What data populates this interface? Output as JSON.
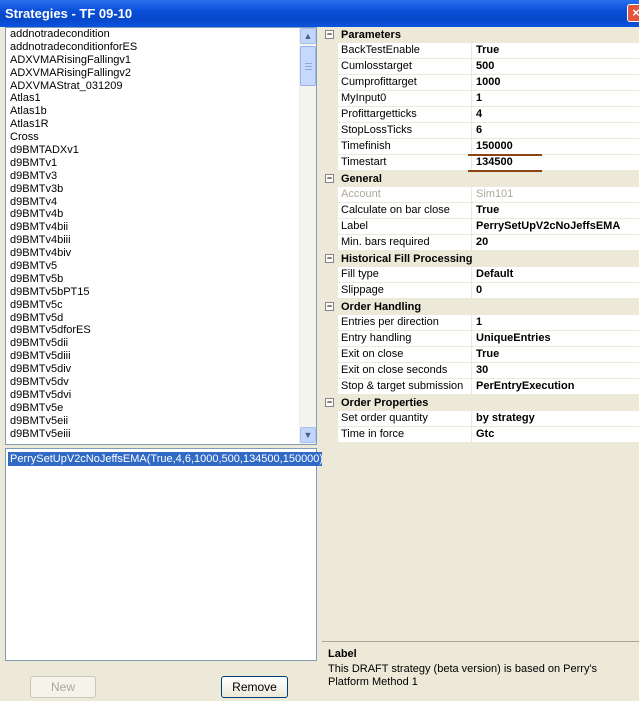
{
  "window": {
    "title": "Strategies - TF 09-10",
    "close_glyph": "×"
  },
  "strategies_list": {
    "items": [
      "addnotradecondition",
      "addnotradeconditionforES",
      "ADXVMARisingFallingv1",
      "ADXVMARisingFallingv2",
      "ADXVMAStrat_031209",
      "Atlas1",
      "Atlas1b",
      "Atlas1R",
      "Cross",
      "d9BMTADXv1",
      "d9BMTv1",
      "d9BMTv3",
      "d9BMTv3b",
      "d9BMTv4",
      "d9BMTv4b",
      "d9BMTv4bii",
      "d9BMTv4biii",
      "d9BMTv4biv",
      "d9BMTv5",
      "d9BMTv5b",
      "d9BMTv5bPT15",
      "d9BMTv5c",
      "d9BMTv5d",
      "d9BMTv5dforES",
      "d9BMTv5dii",
      "d9BMTv5diii",
      "d9BMTv5div",
      "d9BMTv5dv",
      "d9BMTv5dvi",
      "d9BMTv5e",
      "d9BMTv5eii",
      "d9BMTv5eiii"
    ]
  },
  "selected_strategy": "PerrySetUpV2cNoJeffsEMA(True,4,6,1000,500,134500,150000)",
  "buttons": {
    "new": "New",
    "remove": "Remove"
  },
  "icons": {
    "scroll_up": "▲",
    "scroll_down": "▼",
    "collapse": "−"
  },
  "properties": {
    "parameters": {
      "label": "Parameters",
      "rows": [
        {
          "name": "BackTestEnable",
          "value": "True"
        },
        {
          "name": "Cumlosstarget",
          "value": "500"
        },
        {
          "name": "Cumprofittarget",
          "value": "1000"
        },
        {
          "name": "MyInput0",
          "value": "1"
        },
        {
          "name": "Profittargetticks",
          "value": "4"
        },
        {
          "name": "StopLossTicks",
          "value": "6"
        },
        {
          "name": "Timefinish",
          "value": "150000"
        },
        {
          "name": "Timestart",
          "value": "134500"
        }
      ]
    },
    "general": {
      "label": "General",
      "rows": [
        {
          "name": "Account",
          "value": "Sim101"
        },
        {
          "name": "Calculate on bar close",
          "value": "True"
        },
        {
          "name": "Label",
          "value": "PerrySetUpV2cNoJeffsEMA"
        },
        {
          "name": "Min. bars required",
          "value": "20"
        }
      ]
    },
    "historical": {
      "label": "Historical Fill Processing",
      "rows": [
        {
          "name": "Fill type",
          "value": "Default"
        },
        {
          "name": "Slippage",
          "value": "0"
        }
      ]
    },
    "order_handling": {
      "label": "Order Handling",
      "rows": [
        {
          "name": "Entries per direction",
          "value": "1"
        },
        {
          "name": "Entry handling",
          "value": "UniqueEntries"
        },
        {
          "name": "Exit on close",
          "value": "True"
        },
        {
          "name": "Exit on close seconds",
          "value": "30"
        },
        {
          "name": "Stop & target submission",
          "value": "PerEntryExecution"
        }
      ]
    },
    "order_properties": {
      "label": "Order Properties",
      "rows": [
        {
          "name": "Set order quantity",
          "value": "by strategy"
        },
        {
          "name": "Time in force",
          "value": "Gtc"
        }
      ]
    }
  },
  "description": {
    "title": "Label",
    "text": "This DRAFT strategy (beta version) is based on Perry's Platform Method 1"
  }
}
